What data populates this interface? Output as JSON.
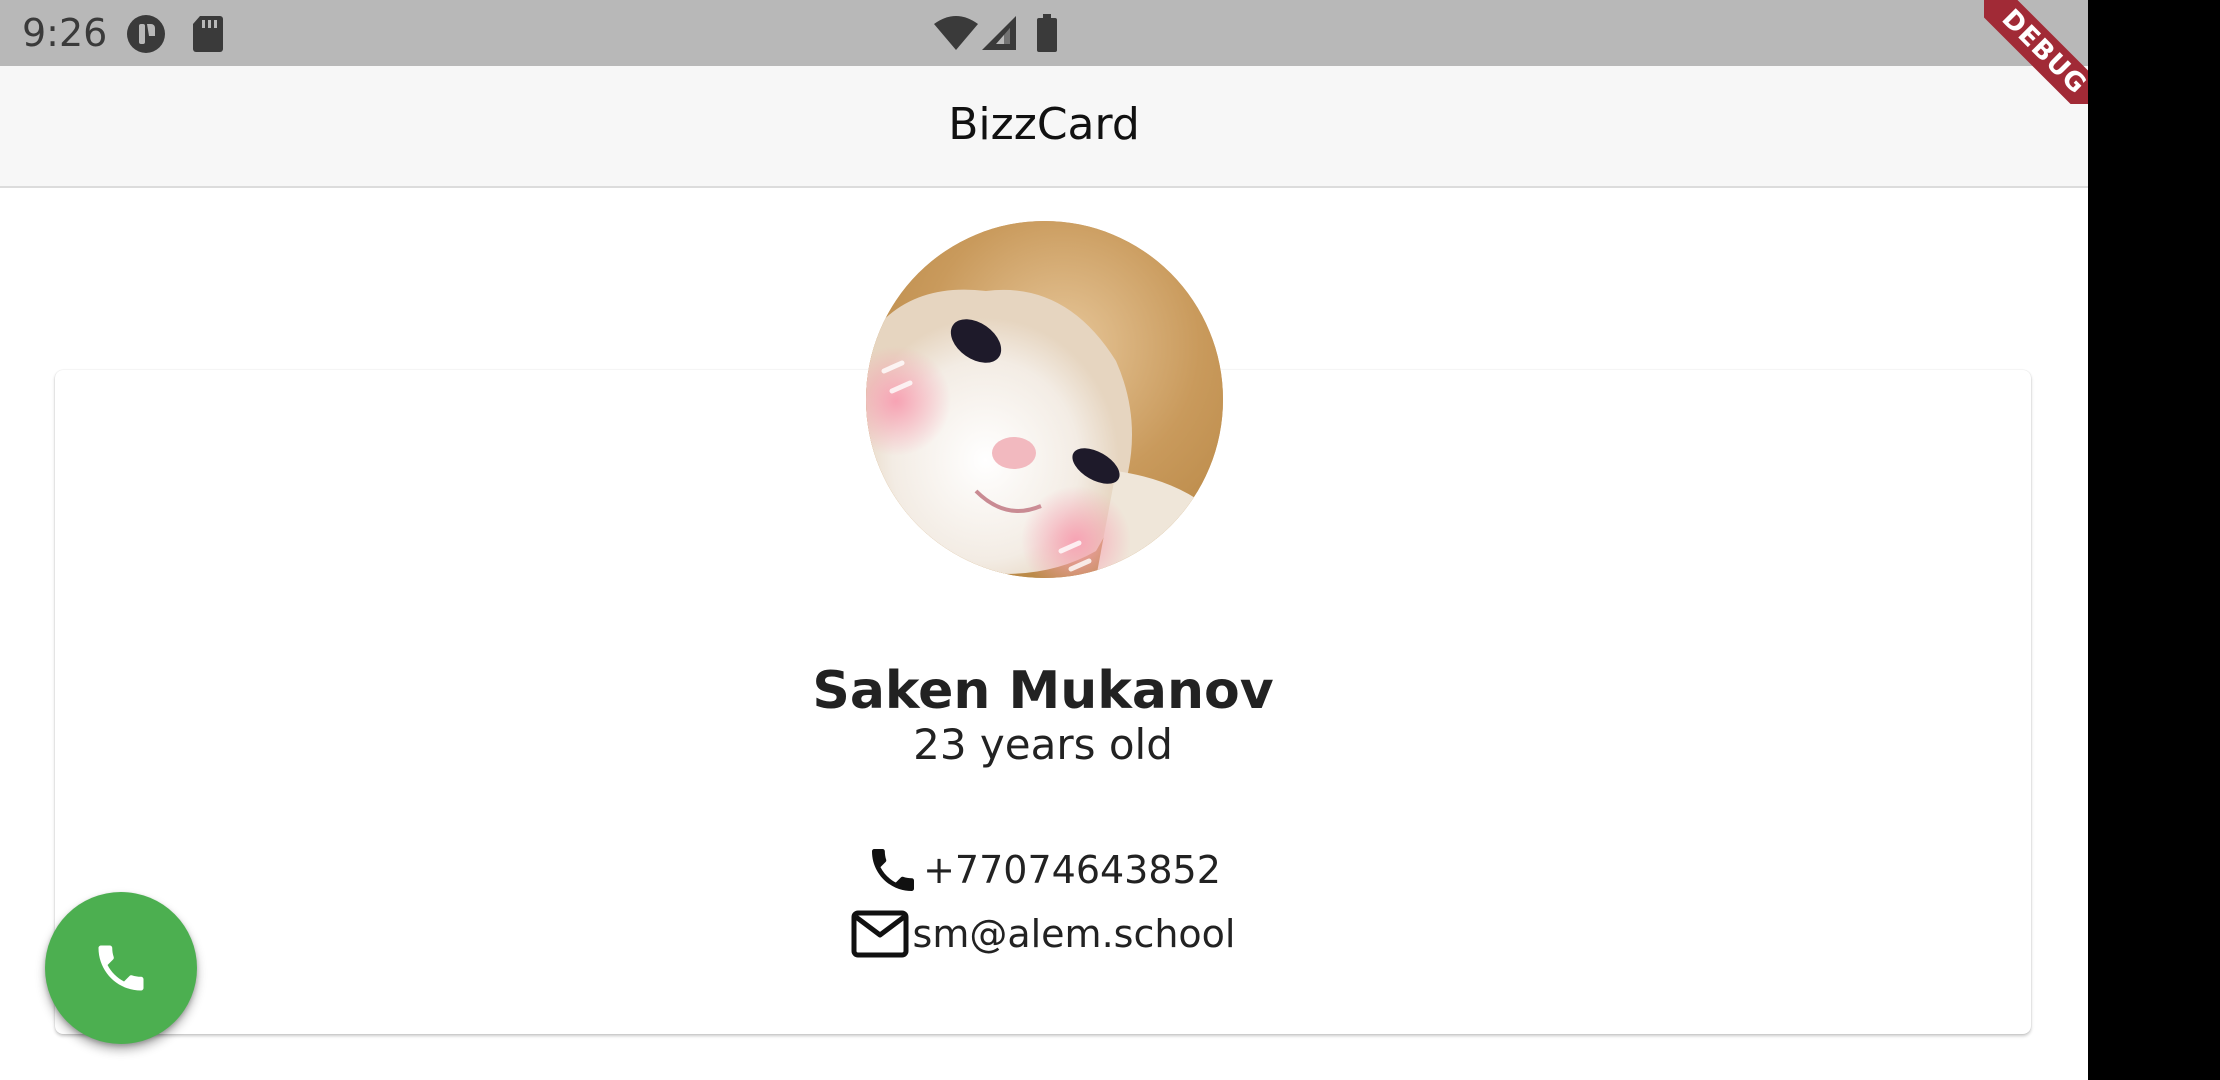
{
  "status_bar": {
    "time": "9:26",
    "icons": [
      "app-notification-icon",
      "sd-card-icon",
      "wifi-icon",
      "cell-signal-icon",
      "battery-icon"
    ]
  },
  "app_bar": {
    "title": "BizzCard"
  },
  "debug_banner": {
    "label": "DEBUG",
    "color": "#a12a36"
  },
  "profile": {
    "avatar": "cat-avatar",
    "name": "Saken Mukanov",
    "age": "23 years old",
    "phone": "+77074643852",
    "email": "sm@alem.school",
    "phone_icon": "phone-icon",
    "email_icon": "mail-icon"
  },
  "fab": {
    "icon": "phone-icon",
    "color": "#4caf50"
  }
}
